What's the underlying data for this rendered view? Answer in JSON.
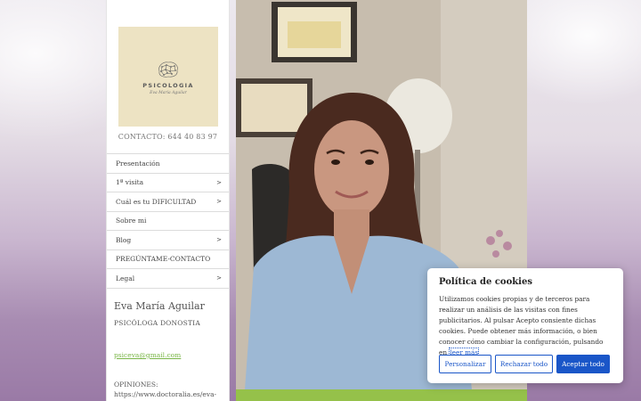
{
  "brand": {
    "title": "PSICOLOGIA",
    "subtitle": "Eva María Aguilar"
  },
  "contact": "CONTACTO: 644 40 83 97",
  "nav": {
    "items": [
      {
        "label": "Presentación",
        "chevron": ""
      },
      {
        "label": "1ª visita",
        "chevron": ">"
      },
      {
        "label": "Cuál es tu DIFICULTAD",
        "chevron": ">"
      },
      {
        "label": "Sobre mi",
        "chevron": ""
      },
      {
        "label": "Blog",
        "chevron": ">"
      },
      {
        "label": "PREGÚNTAME-CONTACTO",
        "chevron": ""
      },
      {
        "label": "Legal",
        "chevron": ">"
      }
    ]
  },
  "profile": {
    "name": "Eva María Aguilar",
    "role": "PSICÓLOGA DONOSTIA",
    "email": "psiceva@gmail.com",
    "opiniones": "OPINIONES: https://www.doctoralia.es/eva-"
  },
  "cookie": {
    "title": "Política de cookies",
    "text": "Utilizamos cookies propias y de terceros para realizar un análisis de las visitas con fines publicitarios. Al pulsar Acepto consiente dichas cookies. Puede obtener más información, o bien conocer cómo cambiar la configuración, pulsando en ",
    "link": "leer más",
    "customize": "Personalizar",
    "reject": "Rechazar todo",
    "accept": "Aceptar todo"
  },
  "colors": {
    "accent": "#1a56c8",
    "green": "#95c14a",
    "logo_bg": "#ede3c3"
  }
}
